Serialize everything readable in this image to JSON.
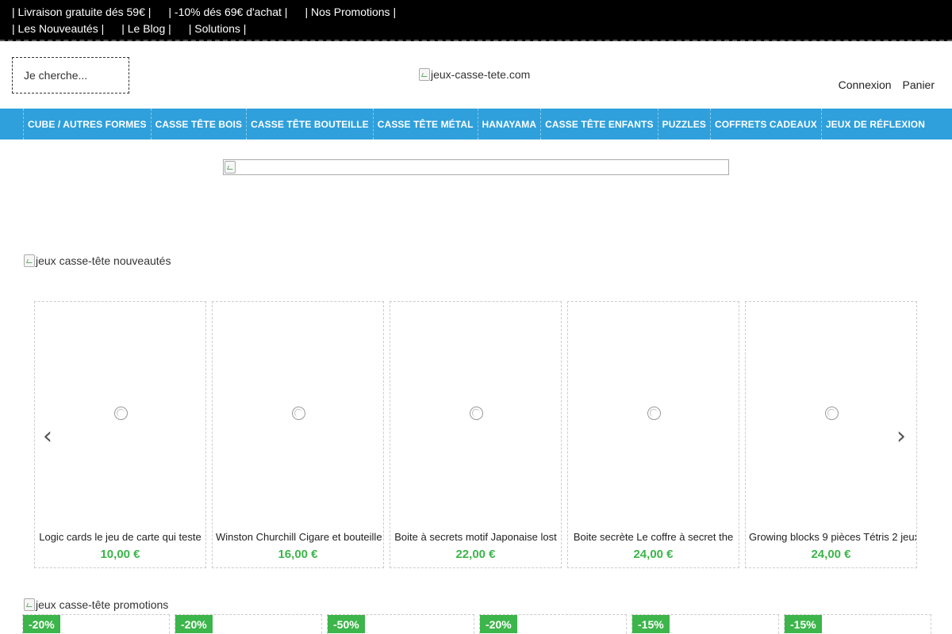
{
  "topbar": {
    "row1": [
      "| Livraison gratuite dés 59€ |",
      "| -10% dés 69€ d'achat |",
      "| Nos Promotions |"
    ],
    "row2": [
      "| Les Nouveautés |",
      "| Le Blog |",
      "| Solutions |"
    ]
  },
  "header": {
    "search_placeholder": "Je  cherche...",
    "logo_alt": "jeux-casse-tete.com",
    "login": "Connexion",
    "cart": "Panier"
  },
  "nav": {
    "items": [
      "CUBE / AUTRES FORMES",
      "CASSE TÊTE BOIS",
      "CASSE TÊTE BOUTEILLE",
      "CASSE TÊTE MÉTAL",
      "HANAYAMA",
      "CASSE TÊTE ENFANTS",
      "PUZZLES",
      "COFFRETS CADEAUX",
      "JEUX DE RÉFLEXION"
    ]
  },
  "sections": {
    "new_title": "jeux casse-tête nouveautés",
    "promo_title": "jeux casse-tête promotions"
  },
  "products": [
    {
      "name": "Logic cards le jeu de carte qui teste",
      "price": "10,00 €"
    },
    {
      "name": "Winston Churchill Cigare et bouteille",
      "price": "16,00 €"
    },
    {
      "name": "Boite à secrets motif Japonaise lost",
      "price": "22,00 €"
    },
    {
      "name": "Boite secrète Le coffre à secret the",
      "price": "24,00 €"
    },
    {
      "name": "Growing blocks 9 pièces Tétris 2 jeux",
      "price": "24,00 €"
    }
  ],
  "carousel": {
    "prev_icon": "chevron-left-icon",
    "next_icon": "chevron-right-icon",
    "prev": "‹",
    "next": "›"
  },
  "promos": [
    "-20%",
    "-20%",
    "-50%",
    "-20%",
    "-15%",
    "-15%"
  ],
  "colors": {
    "nav": "#2fa0db",
    "price": "#3cb54a",
    "topbar": "#000000"
  }
}
